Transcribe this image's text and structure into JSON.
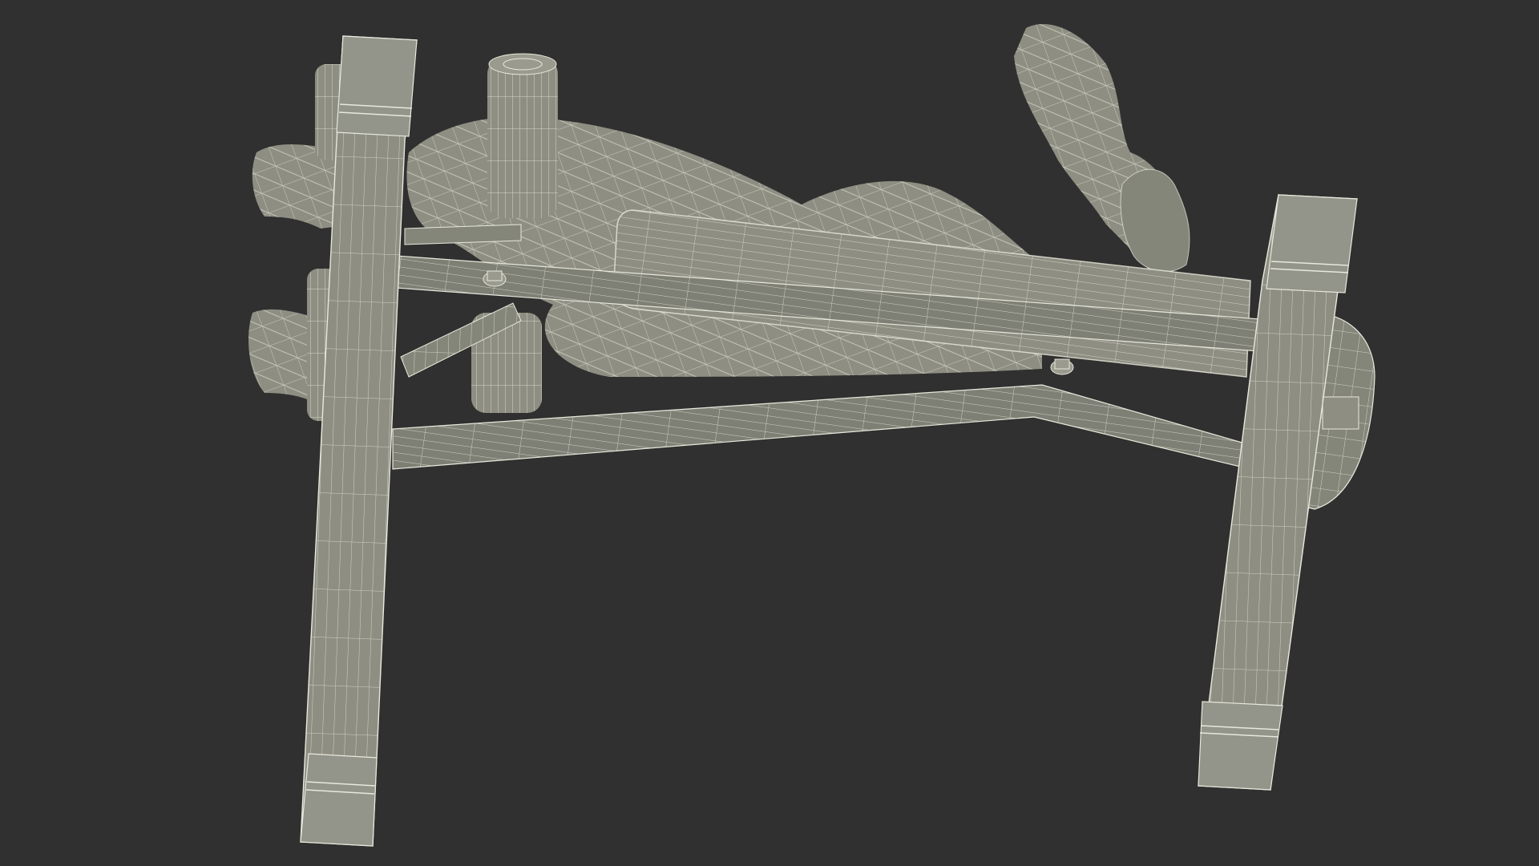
{
  "scene": {
    "background_color": "#303030",
    "model_fill": "#8e8f82",
    "model_fill_dark": "#6f7066",
    "model_fill_light": "#a3a497",
    "wire_color": "#e8e8dc",
    "render_style": "wireframe-over-shaded"
  }
}
